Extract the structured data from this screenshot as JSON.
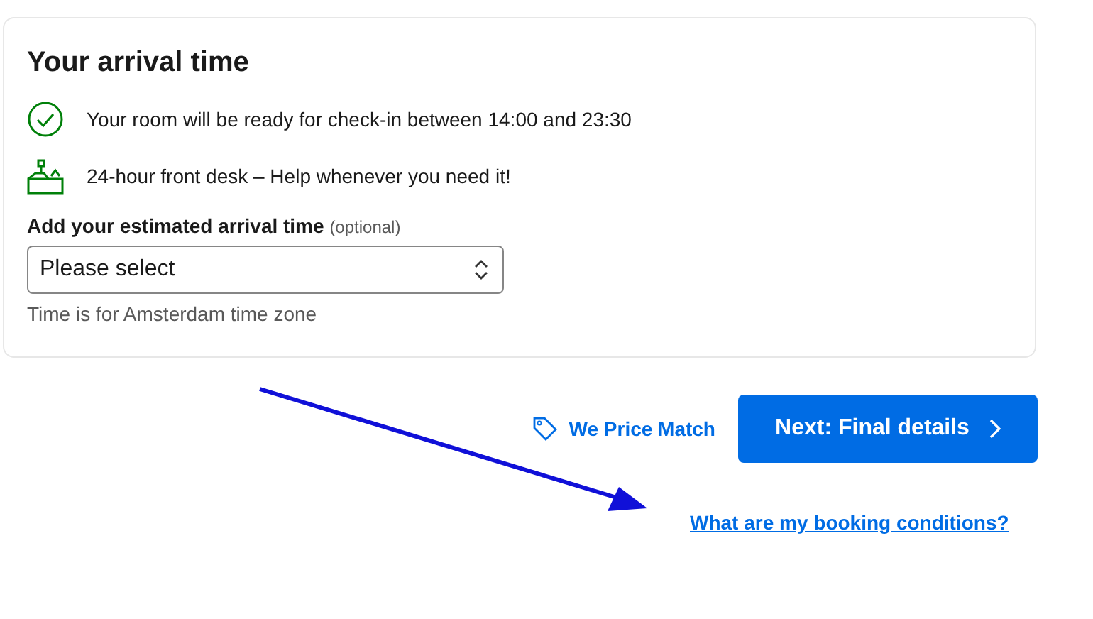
{
  "card": {
    "title": "Your arrival time",
    "facts": [
      {
        "kind": "check",
        "text": "Your room will be ready for check-in between 14:00 and 23:30"
      },
      {
        "kind": "desk",
        "text": "24-hour front desk – Help whenever you need it!"
      }
    ],
    "field_label": "Add your estimated arrival time",
    "field_hint": "(optional)",
    "select_value": "Please select",
    "help": "Time is for Amsterdam time zone"
  },
  "price_match": "We Price Match",
  "next_button": "Next: Final details",
  "conditions_link": "What are my booking conditions?"
}
